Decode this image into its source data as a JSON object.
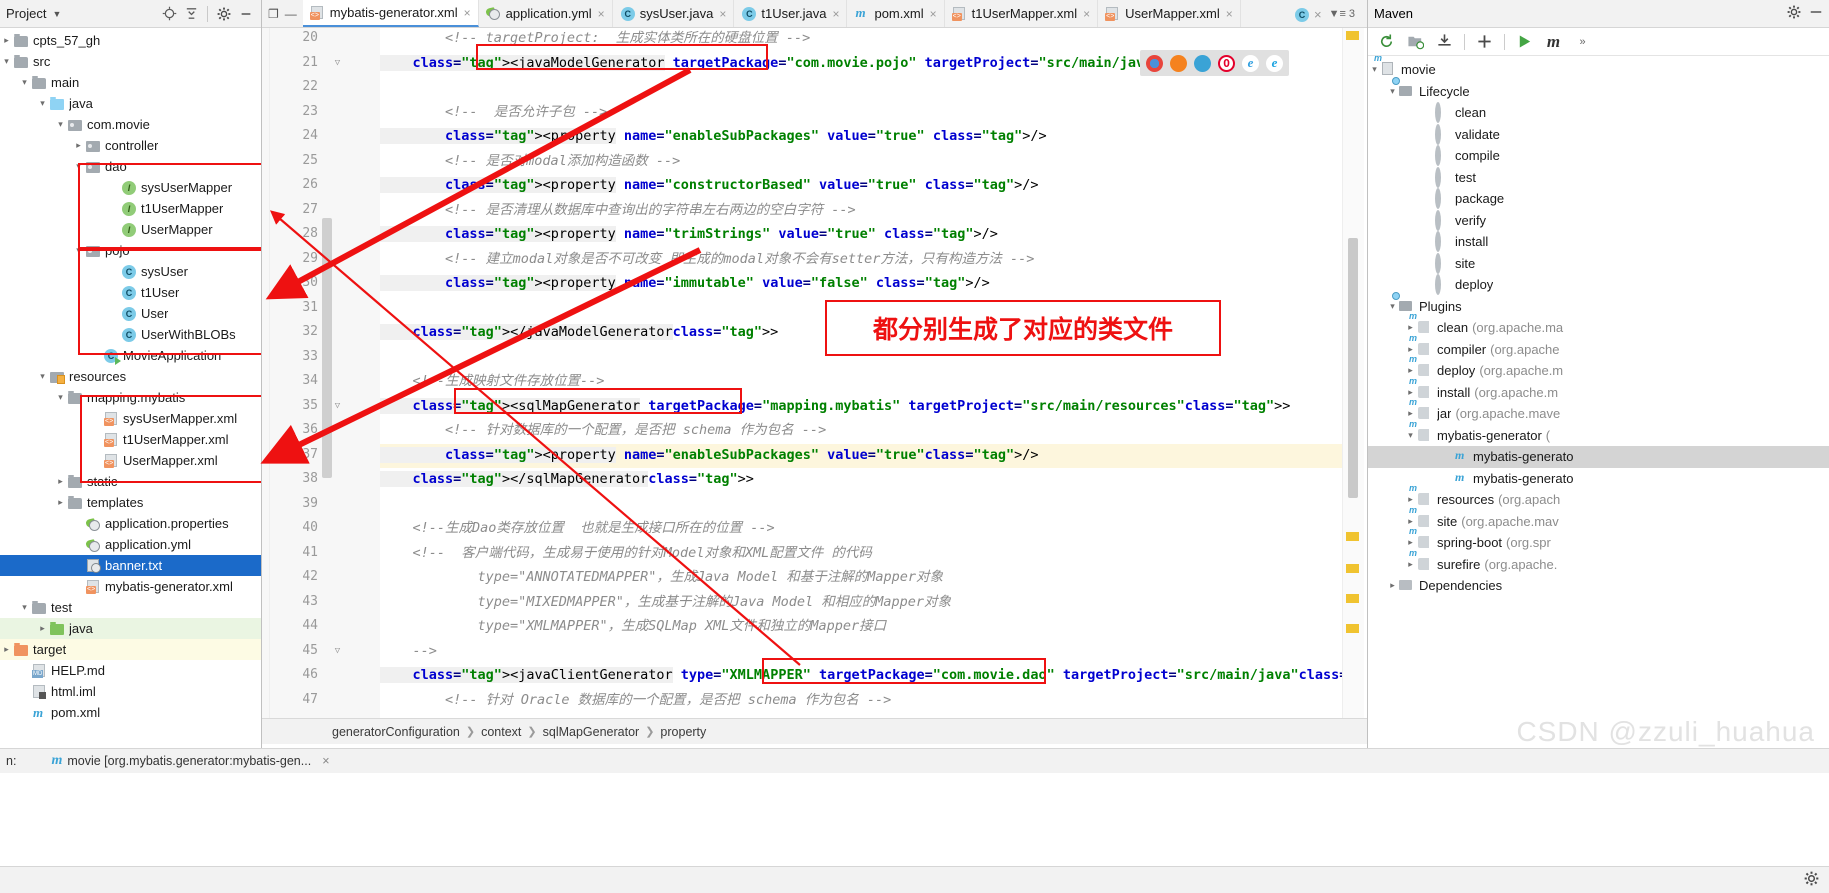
{
  "project_panel": {
    "title": "Project",
    "icons": [
      "locate-icon",
      "collapse-all-icon",
      "gear-icon",
      "minimize-icon"
    ],
    "tree": [
      {
        "label": "cpts_57_gh",
        "depth": 0,
        "arrow": "collapsed",
        "icon": "folder-gray"
      },
      {
        "label": "src",
        "depth": 0,
        "arrow": "expanded",
        "icon": "folder-gray"
      },
      {
        "label": "main",
        "depth": 1,
        "arrow": "expanded",
        "icon": "folder-gray"
      },
      {
        "label": "java",
        "depth": 2,
        "arrow": "expanded",
        "icon": "folder-blue"
      },
      {
        "label": "com.movie",
        "depth": 3,
        "arrow": "expanded",
        "icon": "folder-package"
      },
      {
        "label": "controller",
        "depth": 4,
        "arrow": "collapsed",
        "icon": "folder-package"
      },
      {
        "label": "dao",
        "depth": 4,
        "arrow": "expanded",
        "icon": "folder-package"
      },
      {
        "label": "sysUserMapper",
        "depth": 6,
        "arrow": "none",
        "icon": "interface"
      },
      {
        "label": "t1UserMapper",
        "depth": 6,
        "arrow": "none",
        "icon": "interface"
      },
      {
        "label": "UserMapper",
        "depth": 6,
        "arrow": "none",
        "icon": "interface"
      },
      {
        "label": "pojo",
        "depth": 4,
        "arrow": "expanded",
        "icon": "folder-package"
      },
      {
        "label": "sysUser",
        "depth": 6,
        "arrow": "none",
        "icon": "class"
      },
      {
        "label": "t1User",
        "depth": 6,
        "arrow": "none",
        "icon": "class"
      },
      {
        "label": "User",
        "depth": 6,
        "arrow": "none",
        "icon": "class"
      },
      {
        "label": "UserWithBLOBs",
        "depth": 6,
        "arrow": "none",
        "icon": "class"
      },
      {
        "label": "MovieApplication",
        "depth": 5,
        "arrow": "none",
        "icon": "spring-boot-class"
      },
      {
        "label": "resources",
        "depth": 2,
        "arrow": "expanded",
        "icon": "folder-resources"
      },
      {
        "label": "mapping.mybatis",
        "depth": 3,
        "arrow": "expanded",
        "icon": "folder-gray"
      },
      {
        "label": "sysUserMapper.xml",
        "depth": 5,
        "arrow": "none",
        "icon": "xml"
      },
      {
        "label": "t1UserMapper.xml",
        "depth": 5,
        "arrow": "none",
        "icon": "xml"
      },
      {
        "label": "UserMapper.xml",
        "depth": 5,
        "arrow": "none",
        "icon": "xml"
      },
      {
        "label": "static",
        "depth": 3,
        "arrow": "collapsed",
        "icon": "folder-gray"
      },
      {
        "label": "templates",
        "depth": 3,
        "arrow": "collapsed",
        "icon": "folder-gray"
      },
      {
        "label": "application.properties",
        "depth": 4,
        "arrow": "none",
        "icon": "yml"
      },
      {
        "label": "application.yml",
        "depth": 4,
        "arrow": "none",
        "icon": "yml"
      },
      {
        "label": "banner.txt",
        "depth": 4,
        "arrow": "none",
        "icon": "txt",
        "selected": true
      },
      {
        "label": "mybatis-generator.xml",
        "depth": 4,
        "arrow": "none",
        "icon": "xml"
      },
      {
        "label": "test",
        "depth": 1,
        "arrow": "expanded",
        "icon": "folder-gray"
      },
      {
        "label": "java",
        "depth": 2,
        "arrow": "collapsed",
        "icon": "folder-green",
        "rowbg": "green"
      },
      {
        "label": "target",
        "depth": 0,
        "arrow": "collapsed",
        "icon": "folder-orange",
        "rowbg": "yellow"
      },
      {
        "label": "HELP.md",
        "depth": 1,
        "arrow": "none",
        "icon": "md"
      },
      {
        "label": "html.iml",
        "depth": 1,
        "arrow": "none",
        "icon": "iml"
      },
      {
        "label": "pom.xml",
        "depth": 1,
        "arrow": "none",
        "icon": "maven"
      }
    ]
  },
  "tabs": [
    {
      "label": "mybatis-generator.xml",
      "icon": "xml-icon",
      "active": true
    },
    {
      "label": "application.yml",
      "icon": "yml-icon",
      "active": false
    },
    {
      "label": "sysUser.java",
      "icon": "class-icon",
      "active": false
    },
    {
      "label": "t1User.java",
      "icon": "class-icon",
      "active": false
    },
    {
      "label": "pom.xml",
      "icon": "maven-icon",
      "active": false
    },
    {
      "label": "t1UserMapper.xml",
      "icon": "xml-icon",
      "active": false
    },
    {
      "label": "UserMapper.xml",
      "icon": "xml-icon",
      "active": false
    }
  ],
  "tabs_overflow": {
    "count": "3",
    "extra_tab_icon": "class-icon"
  },
  "editor": {
    "first_line": 20,
    "lines": [
      {
        "n": 20,
        "text": "        <!-- targetProject:  生成实体类所在的硬盘位置 -->",
        "type": "comment"
      },
      {
        "n": 21,
        "text": "    <javaModelGenerator targetPackage=\"com.movie.pojo\" targetProject=\"src/main/java\">",
        "type": "code",
        "fold": true
      },
      {
        "n": 22,
        "text": "",
        "type": "blank"
      },
      {
        "n": 23,
        "text": "        <!--  是否允许子包 -->",
        "type": "comment"
      },
      {
        "n": 24,
        "text": "        <property name=\"enableSubPackages\" value=\"true\" />",
        "type": "code"
      },
      {
        "n": 25,
        "text": "        <!-- 是否对modal添加构造函数 -->",
        "type": "comment"
      },
      {
        "n": 26,
        "text": "        <property name=\"constructorBased\" value=\"true\" />",
        "type": "code"
      },
      {
        "n": 27,
        "text": "        <!-- 是否清理从数据库中查询出的字符串左右两边的空白字符 -->",
        "type": "comment"
      },
      {
        "n": 28,
        "text": "        <property name=\"trimStrings\" value=\"true\" />",
        "type": "code"
      },
      {
        "n": 29,
        "text": "        <!-- 建立modal对象是否不可改变 即生成的modal对象不会有setter方法，只有构造方法 -->",
        "type": "comment"
      },
      {
        "n": 30,
        "text": "        <property name=\"immutable\" value=\"false\" />",
        "type": "code"
      },
      {
        "n": 31,
        "text": "",
        "type": "blank"
      },
      {
        "n": 32,
        "text": "    </javaModelGenerator>",
        "type": "code"
      },
      {
        "n": 33,
        "text": "",
        "type": "blank"
      },
      {
        "n": 34,
        "text": "    <!--生成映射文件存放位置-->",
        "type": "comment"
      },
      {
        "n": 35,
        "text": "    <sqlMapGenerator targetPackage=\"mapping.mybatis\" targetProject=\"src/main/resources\">",
        "type": "code",
        "fold": true
      },
      {
        "n": 36,
        "text": "        <!-- 针对数据库的一个配置，是否把 schema 作为包名 -->",
        "type": "comment"
      },
      {
        "n": 37,
        "text": "        <property name=\"enableSubPackages\" value=\"true\"/>",
        "type": "code",
        "highlight": true
      },
      {
        "n": 38,
        "text": "    </sqlMapGenerator>",
        "type": "code"
      },
      {
        "n": 39,
        "text": "",
        "type": "blank"
      },
      {
        "n": 40,
        "text": "    <!--生成Dao类存放位置  也就是生成接口所在的位置 -->",
        "type": "comment"
      },
      {
        "n": 41,
        "text": "    <!--  客户端代码，生成易于使用的针对Model对象和XML配置文件 的代码",
        "type": "comment"
      },
      {
        "n": 42,
        "text": "            type=\"ANNOTATEDMAPPER\"，生成Java Model 和基于注解的Mapper对象",
        "type": "comment"
      },
      {
        "n": 43,
        "text": "            type=\"MIXEDMAPPER\"，生成基于注解的Java Model 和相应的Mapper对象",
        "type": "comment"
      },
      {
        "n": 44,
        "text": "            type=\"XMLMAPPER\"，生成SQLMap XML文件和独立的Mapper接口",
        "type": "comment"
      },
      {
        "n": 45,
        "text": "    -->",
        "type": "comment",
        "fold": true
      },
      {
        "n": 46,
        "text": "    <javaClientGenerator type=\"XMLMAPPER\" targetPackage=\"com.movie.dao\" targetProject=\"src/main/java\">",
        "type": "code"
      },
      {
        "n": 47,
        "text": "        <!-- 针对 Oracle 数据库的一个配置，是否把 schema 作为包名 -->",
        "type": "comment"
      }
    ]
  },
  "annotation": {
    "note_text": "都分别生成了对应的类文件",
    "accent_color": "#ee1111"
  },
  "browser_hint": {
    "icons": [
      "chrome-icon",
      "firefox-icon",
      "safari-icon",
      "opera-icon",
      "edge-icon",
      "ie-icon"
    ]
  },
  "breadcrumb": {
    "items": [
      "generatorConfiguration",
      "context",
      "sqlMapGenerator",
      "property"
    ]
  },
  "maven_panel": {
    "title": "Maven",
    "header_icons": [
      "gear-icon",
      "minimize-icon"
    ],
    "toolbar_icons": [
      "refresh-icon",
      "add-maven-project-icon",
      "download-sources-icon",
      "plus-icon",
      "run-icon",
      "execute-maven-goal-icon",
      "more-icon"
    ],
    "tree": [
      {
        "label": "movie",
        "suffix": "",
        "depth": 0,
        "arrow": "expanded",
        "icon": "maven-module"
      },
      {
        "label": "Lifecycle",
        "suffix": "",
        "depth": 1,
        "arrow": "expanded",
        "icon": "phase-folder"
      },
      {
        "label": "clean",
        "suffix": "",
        "depth": 3,
        "arrow": "none",
        "icon": "gear"
      },
      {
        "label": "validate",
        "suffix": "",
        "depth": 3,
        "arrow": "none",
        "icon": "gear"
      },
      {
        "label": "compile",
        "suffix": "",
        "depth": 3,
        "arrow": "none",
        "icon": "gear"
      },
      {
        "label": "test",
        "suffix": "",
        "depth": 3,
        "arrow": "none",
        "icon": "gear"
      },
      {
        "label": "package",
        "suffix": "",
        "depth": 3,
        "arrow": "none",
        "icon": "gear"
      },
      {
        "label": "verify",
        "suffix": "",
        "depth": 3,
        "arrow": "none",
        "icon": "gear"
      },
      {
        "label": "install",
        "suffix": "",
        "depth": 3,
        "arrow": "none",
        "icon": "gear"
      },
      {
        "label": "site",
        "suffix": "",
        "depth": 3,
        "arrow": "none",
        "icon": "gear"
      },
      {
        "label": "deploy",
        "suffix": "",
        "depth": 3,
        "arrow": "none",
        "icon": "gear"
      },
      {
        "label": "Plugins",
        "suffix": "",
        "depth": 1,
        "arrow": "expanded",
        "icon": "phase-folder"
      },
      {
        "label": "clean",
        "suffix": "(org.apache.ma",
        "depth": 2,
        "arrow": "collapsed",
        "icon": "plugin"
      },
      {
        "label": "compiler",
        "suffix": "(org.apache",
        "depth": 2,
        "arrow": "collapsed",
        "icon": "plugin"
      },
      {
        "label": "deploy",
        "suffix": "(org.apache.m",
        "depth": 2,
        "arrow": "collapsed",
        "icon": "plugin"
      },
      {
        "label": "install",
        "suffix": "(org.apache.m",
        "depth": 2,
        "arrow": "collapsed",
        "icon": "plugin"
      },
      {
        "label": "jar",
        "suffix": "(org.apache.mave",
        "depth": 2,
        "arrow": "collapsed",
        "icon": "plugin"
      },
      {
        "label": "mybatis-generator",
        "suffix": "(",
        "depth": 2,
        "arrow": "expanded",
        "icon": "plugin"
      },
      {
        "label": "mybatis-generato",
        "suffix": "",
        "depth": 4,
        "arrow": "none",
        "icon": "goal",
        "selected": true
      },
      {
        "label": "mybatis-generato",
        "suffix": "",
        "depth": 4,
        "arrow": "none",
        "icon": "goal"
      },
      {
        "label": "resources",
        "suffix": "(org.apach",
        "depth": 2,
        "arrow": "collapsed",
        "icon": "plugin"
      },
      {
        "label": "site",
        "suffix": "(org.apache.mav",
        "depth": 2,
        "arrow": "collapsed",
        "icon": "plugin"
      },
      {
        "label": "spring-boot",
        "suffix": "(org.spr",
        "depth": 2,
        "arrow": "collapsed",
        "icon": "plugin"
      },
      {
        "label": "surefire",
        "suffix": "(org.apache.",
        "depth": 2,
        "arrow": "collapsed",
        "icon": "plugin"
      },
      {
        "label": "Dependencies",
        "suffix": "",
        "depth": 1,
        "arrow": "collapsed",
        "icon": "dependencies"
      }
    ]
  },
  "status_bar": {
    "prefix": "n:",
    "text": "movie [org.mybatis.generator:mybatis-gen...",
    "close_label": "×"
  },
  "watermark": {
    "text": "CSDN @zzuli_huahua"
  }
}
